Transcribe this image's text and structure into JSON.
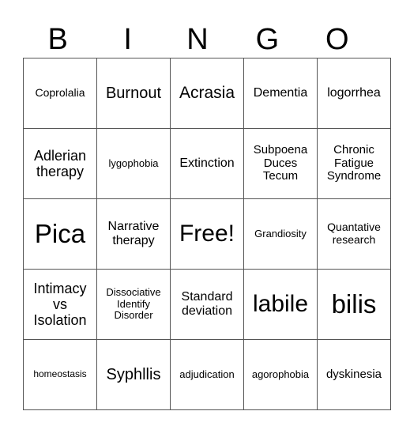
{
  "header": [
    "B",
    "I",
    "N",
    "G",
    "O"
  ],
  "cells": [
    [
      {
        "text": "Coprolalia",
        "size": 14
      },
      {
        "text": "Burnout",
        "size": 20
      },
      {
        "text": "Acrasia",
        "size": 21
      },
      {
        "text": "Dementia",
        "size": 16
      },
      {
        "text": "logorrhea",
        "size": 16
      }
    ],
    [
      {
        "text": "Adlerian therapy",
        "size": 18
      },
      {
        "text": "lygophobia",
        "size": 13
      },
      {
        "text": "Extinction",
        "size": 16
      },
      {
        "text": "Subpoena Duces Tecum",
        "size": 15
      },
      {
        "text": "Chronic Fatigue Syndrome",
        "size": 15
      }
    ],
    [
      {
        "text": "Pica",
        "size": 33
      },
      {
        "text": "Narrative therapy",
        "size": 16
      },
      {
        "text": "Free!",
        "size": 30
      },
      {
        "text": "Grandiosity",
        "size": 13
      },
      {
        "text": "Quantative research",
        "size": 14
      }
    ],
    [
      {
        "text": "Intimacy vs Isolation",
        "size": 18
      },
      {
        "text": "Dissociative Identify Disorder",
        "size": 13
      },
      {
        "text": "Standard deviation",
        "size": 16
      },
      {
        "text": "labile",
        "size": 30
      },
      {
        "text": "bilis",
        "size": 33
      }
    ],
    [
      {
        "text": "homeostasis",
        "size": 12
      },
      {
        "text": "Syphllis",
        "size": 20
      },
      {
        "text": "adjudication",
        "size": 13
      },
      {
        "text": "agorophobia",
        "size": 13
      },
      {
        "text": "dyskinesia",
        "size": 15
      }
    ]
  ]
}
